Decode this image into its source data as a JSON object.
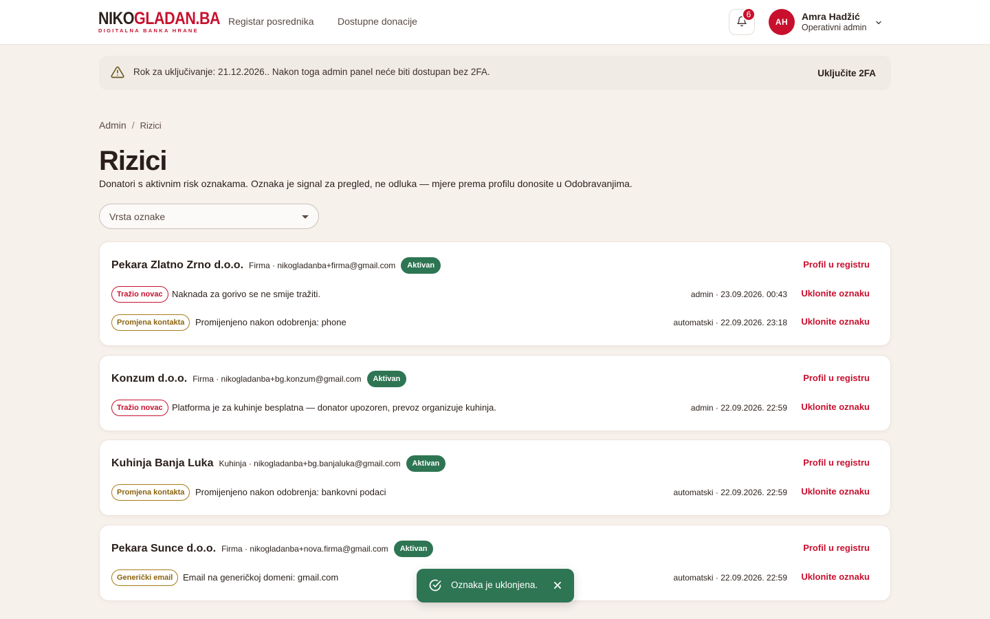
{
  "header": {
    "logo_main_dark": "NIKO",
    "logo_main_red": "GLADAN.BA",
    "logo_sub": "DIGITALNA BANKA HRANE",
    "nav": [
      {
        "label": "Registar posrednika"
      },
      {
        "label": "Dostupne donacije"
      }
    ],
    "notifications_count": "6",
    "user": {
      "initials": "AH",
      "name": "Amra Hadžić",
      "role": "Operativni admin"
    }
  },
  "alert": {
    "text": "Rok za uključivanje: 21.12.2026.. Nakon toga admin panel neće biti dostupan bez 2FA.",
    "action": "Uključite 2FA"
  },
  "breadcrumb": {
    "root": "Admin",
    "separator": "/",
    "current": "Rizici"
  },
  "page": {
    "title": "Rizici",
    "description": "Donatori s aktivnim risk oznakama. Oznaka je signal za pregled, ne odluka — mjere prema profilu donosite u Odobravanjima."
  },
  "filter": {
    "label": "Vrsta oznake"
  },
  "cards": [
    {
      "name": "Pekara Zlatno Zrno d.o.o.",
      "meta": "Firma · nikogladanba+firma@gmail.com",
      "status": "Aktivan",
      "profile_link": "Profil u registru",
      "flags": [
        {
          "tag": "Tražio novac",
          "text": "Naknada za gorivo se ne smije tražiti.",
          "meta": "admin · 23.09.2026. 00:43",
          "action": "Uklonite oznaku"
        },
        {
          "tag": "Promjena kontakta",
          "text": "Promijenjeno nakon odobrenja: phone",
          "meta": "automatski · 22.09.2026. 23:18",
          "action": "Uklonite oznaku"
        }
      ]
    },
    {
      "name": "Konzum d.o.o.",
      "meta": "Firma · nikogladanba+bg.konzum@gmail.com",
      "status": "Aktivan",
      "profile_link": "Profil u registru",
      "flags": [
        {
          "tag": "Tražio novac",
          "text": "Platforma je za kuhinje besplatna — donator upozoren, prevoz organizuje kuhinja.",
          "meta": "admin · 22.09.2026. 22:59",
          "action": "Uklonite oznaku"
        }
      ]
    },
    {
      "name": "Kuhinja Banja Luka",
      "meta": "Kuhinja · nikogladanba+bg.banjaluka@gmail.com",
      "status": "Aktivan",
      "profile_link": "Profil u registru",
      "flags": [
        {
          "tag": "Promjena kontakta",
          "text": "Promijenjeno nakon odobrenja: bankovni podaci",
          "meta": "automatski · 22.09.2026. 22:59",
          "action": "Uklonite oznaku"
        }
      ]
    },
    {
      "name": "Pekara Sunce d.o.o.",
      "meta": "Firma · nikogladanba+nova.firma@gmail.com",
      "status": "Aktivan",
      "profile_link": "Profil u registru",
      "flags": [
        {
          "tag": "Generički email",
          "text": "Email na generičkoj domeni: gmail.com",
          "meta": "automatski · 22.09.2026. 22:59",
          "action": "Uklonite oznaku"
        }
      ]
    }
  ],
  "toast": {
    "text": "Oznaka je uklonjena."
  },
  "colors": {
    "brand": "#c8102e",
    "success": "#2e7553",
    "warning_tag": "#a67c1a",
    "background": "#f7f1ec"
  }
}
